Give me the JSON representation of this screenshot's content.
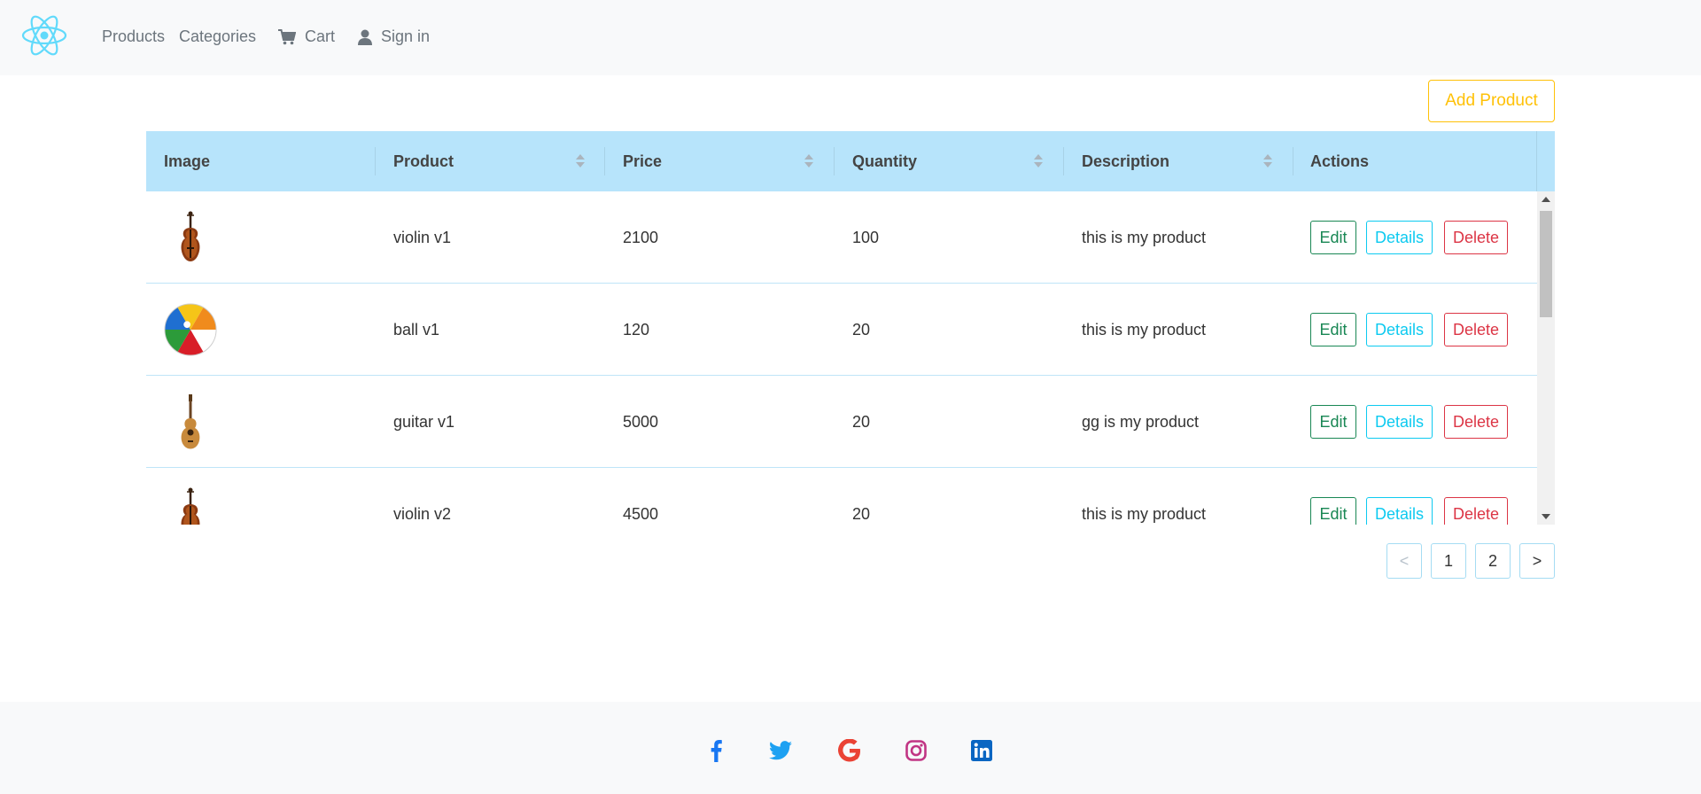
{
  "nav": {
    "logo_icon": "react-logo-icon",
    "products_label": "Products",
    "categories_label": "Categories",
    "cart_label": "Cart",
    "cart_icon": "cart-icon",
    "signin_label": "Sign in",
    "signin_icon": "user-icon"
  },
  "toolbar": {
    "add_product_label": "Add Product"
  },
  "table": {
    "headers": [
      {
        "label": "Image",
        "sortable": false
      },
      {
        "label": "Product",
        "sortable": true
      },
      {
        "label": "Price",
        "sortable": true
      },
      {
        "label": "Quantity",
        "sortable": true
      },
      {
        "label": "Description",
        "sortable": true
      },
      {
        "label": "Actions",
        "sortable": false
      }
    ],
    "rows": [
      {
        "image_icon": "violin-icon",
        "product": "violin v1",
        "price": "2100",
        "quantity": "100",
        "description": "this is my product"
      },
      {
        "image_icon": "beach-ball-icon",
        "product": "ball v1",
        "price": "120",
        "quantity": "20",
        "description": "this is my product"
      },
      {
        "image_icon": "guitar-icon",
        "product": "guitar v1",
        "price": "5000",
        "quantity": "20",
        "description": "gg is my product"
      },
      {
        "image_icon": "violin-icon",
        "product": "violin v2",
        "price": "4500",
        "quantity": "20",
        "description": "this is my product"
      }
    ],
    "actions": {
      "edit_label": "Edit",
      "details_label": "Details",
      "delete_label": "Delete"
    }
  },
  "pagination": {
    "prev_label": "<",
    "pages": [
      "1",
      "2"
    ],
    "current_page": "1",
    "next_label": ">"
  },
  "footer": {
    "social_icons": [
      "facebook-icon",
      "twitter-icon",
      "google-icon",
      "instagram-icon",
      "linkedin-icon"
    ]
  },
  "colors": {
    "header_bg": "#b7e4fb",
    "navbar_bg": "#f8f9fa",
    "add_button": "#ffc107",
    "edit": "#198754",
    "details": "#0dcaf0",
    "delete": "#dc3545",
    "facebook": "#1877f2",
    "twitter": "#1da1f2",
    "google": "#ea4335",
    "instagram": "#c13584",
    "linkedin": "#0a66c2"
  }
}
